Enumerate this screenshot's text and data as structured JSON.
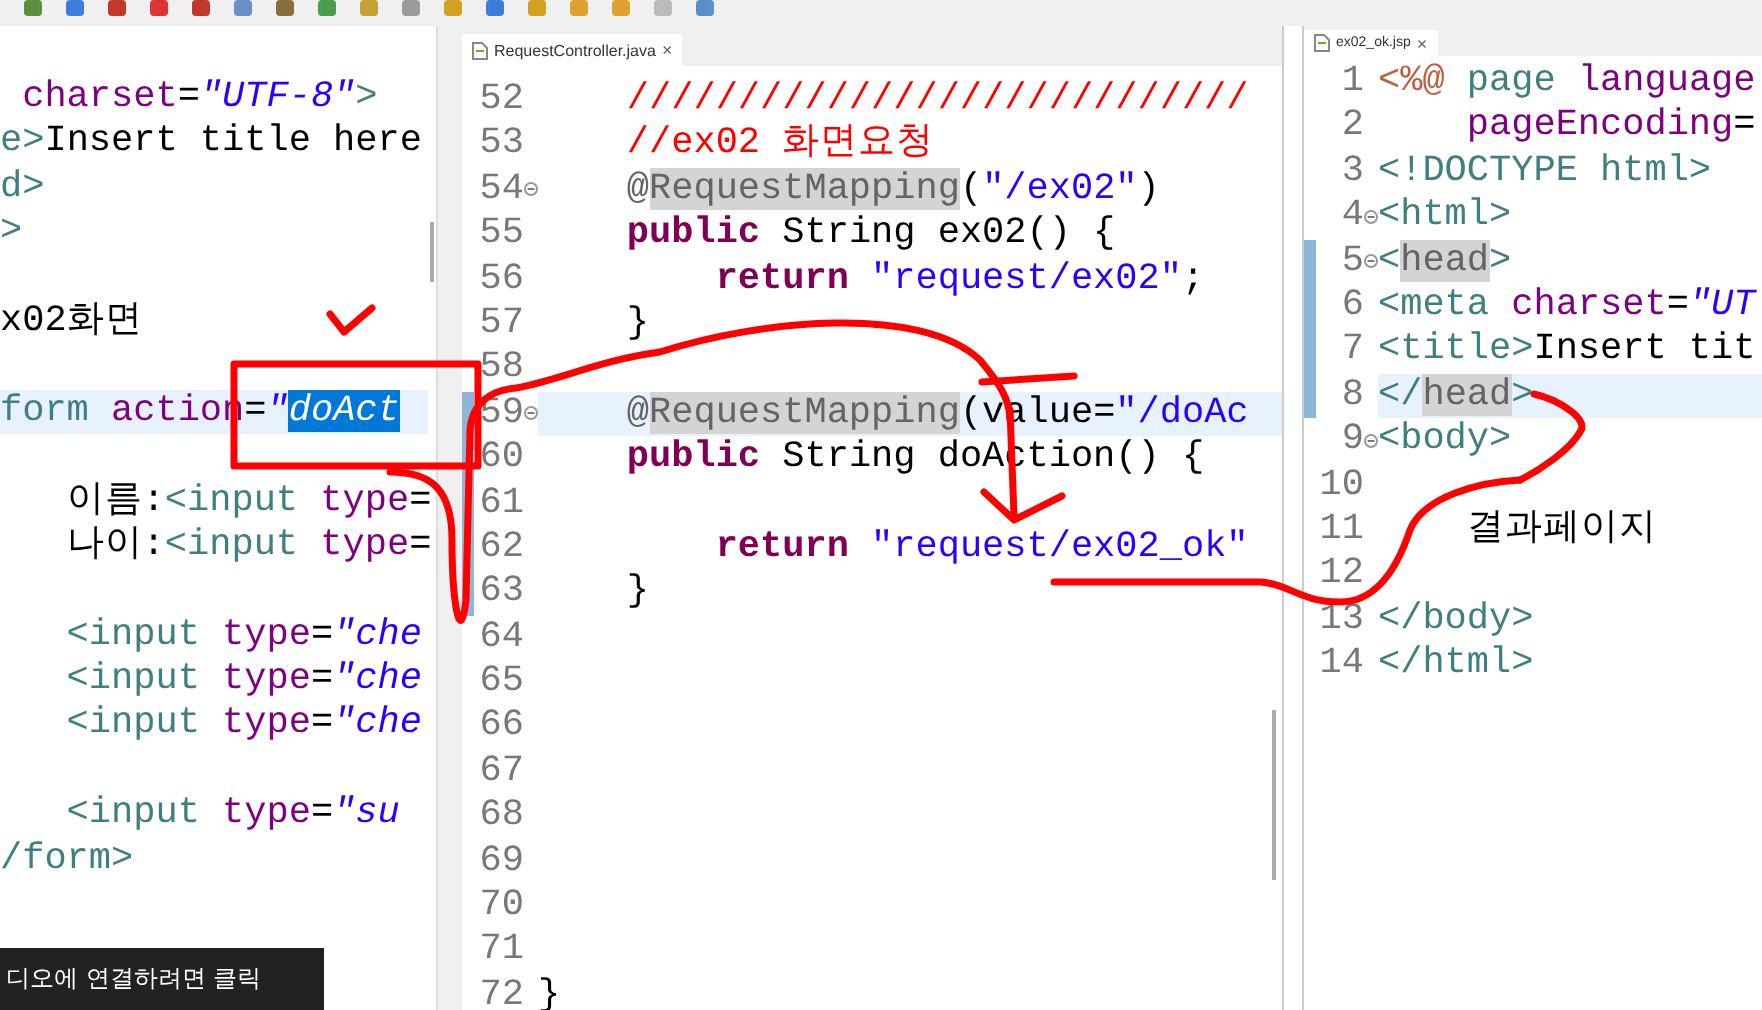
{
  "left_editor": {
    "lines": [
      {
        "current": false,
        "tokens": [
          {
            "kind": "attr",
            "text": " charset"
          },
          {
            "kind": "punct",
            "text": "="
          },
          {
            "kind": "string",
            "text": "\"UTF-8\""
          },
          {
            "kind": "tag",
            "text": ">"
          }
        ]
      },
      {
        "current": false,
        "tokens": [
          {
            "kind": "tag",
            "text": "e>"
          },
          {
            "kind": "text",
            "text": "Insert title here"
          }
        ]
      },
      {
        "current": false,
        "tokens": [
          {
            "kind": "tag",
            "text": "d>"
          }
        ]
      },
      {
        "current": false,
        "tokens": [
          {
            "kind": "tag",
            "text": ">"
          }
        ]
      },
      {
        "current": false
      },
      {
        "current": false,
        "tokens": [
          {
            "kind": "text",
            "text": "x02화면"
          }
        ]
      },
      {
        "current": false
      },
      {
        "current": true,
        "tokens": [
          {
            "kind": "tag",
            "text": "form "
          },
          {
            "kind": "attr",
            "text": "action"
          },
          {
            "kind": "punct",
            "text": "="
          },
          {
            "kind": "string",
            "text": "\""
          },
          {
            "kind": "selection",
            "text": "doAct"
          }
        ]
      },
      {
        "current": false
      },
      {
        "current": false,
        "tokens": [
          {
            "kind": "text",
            "text": "   이름:"
          },
          {
            "kind": "tag",
            "text": "<input "
          },
          {
            "kind": "attr",
            "text": "type"
          },
          {
            "kind": "punct",
            "text": "="
          }
        ]
      },
      {
        "current": false,
        "tokens": [
          {
            "kind": "text",
            "text": "   나이:"
          },
          {
            "kind": "tag",
            "text": "<input "
          },
          {
            "kind": "attr",
            "text": "type"
          },
          {
            "kind": "punct",
            "text": "="
          }
        ]
      },
      {
        "current": false
      },
      {
        "current": false,
        "tokens": [
          {
            "kind": "tag",
            "text": "   <input "
          },
          {
            "kind": "attr",
            "text": "type"
          },
          {
            "kind": "punct",
            "text": "="
          },
          {
            "kind": "string",
            "text": "\"che"
          }
        ]
      },
      {
        "current": false,
        "tokens": [
          {
            "kind": "tag",
            "text": "   <input "
          },
          {
            "kind": "attr",
            "text": "type"
          },
          {
            "kind": "punct",
            "text": "="
          },
          {
            "kind": "string",
            "text": "\"che"
          }
        ]
      },
      {
        "current": false,
        "tokens": [
          {
            "kind": "tag",
            "text": "   <input "
          },
          {
            "kind": "attr",
            "text": "type"
          },
          {
            "kind": "punct",
            "text": "="
          },
          {
            "kind": "string",
            "text": "\"che"
          }
        ]
      },
      {
        "current": false
      },
      {
        "current": false,
        "tokens": [
          {
            "kind": "tag",
            "text": "   <input "
          },
          {
            "kind": "attr",
            "text": "type"
          },
          {
            "kind": "punct",
            "text": "="
          },
          {
            "kind": "string",
            "text": "\"su"
          }
        ]
      },
      {
        "current": false,
        "tokens": [
          {
            "kind": "tag",
            "text": "/form>"
          }
        ]
      }
    ]
  },
  "middle_editor": {
    "tab": {
      "label": "RequestController.java",
      "close": "×"
    },
    "lines": [
      {
        "number": "52",
        "fold": false,
        "changed": false,
        "current": false,
        "tokens": [
          {
            "kind": "comment",
            "text": "    ////////////////////////////"
          }
        ]
      },
      {
        "number": "53",
        "fold": false,
        "changed": false,
        "current": false,
        "tokens": [
          {
            "kind": "comment",
            "text": "    //ex02 화면요청"
          }
        ]
      },
      {
        "number": "54",
        "fold": true,
        "changed": false,
        "current": false,
        "tokens": [
          {
            "kind": "annotation",
            "text": "    @"
          },
          {
            "kind": "mark",
            "text": "RequestMapping"
          },
          {
            "kind": "punct",
            "text": "("
          },
          {
            "kind": "jstring",
            "text": "\"/ex02\""
          },
          {
            "kind": "punct",
            "text": ")"
          }
        ]
      },
      {
        "number": "55",
        "fold": false,
        "changed": false,
        "current": false,
        "tokens": [
          {
            "kind": "keyword",
            "text": "    public"
          },
          {
            "kind": "punct",
            "text": " String ex02() {"
          }
        ]
      },
      {
        "number": "56",
        "fold": false,
        "changed": false,
        "current": false,
        "tokens": [
          {
            "kind": "keyword",
            "text": "        return"
          },
          {
            "kind": "jstring",
            "text": " \"request/ex02\""
          },
          {
            "kind": "punct",
            "text": ";"
          }
        ]
      },
      {
        "number": "57",
        "fold": false,
        "changed": false,
        "current": false,
        "tokens": [
          {
            "kind": "punct",
            "text": "    }"
          }
        ]
      },
      {
        "number": "58",
        "fold": false,
        "changed": false,
        "current": false
      },
      {
        "number": "59",
        "fold": true,
        "changed": true,
        "current": true,
        "tokens": [
          {
            "kind": "annotation",
            "text": "    @"
          },
          {
            "kind": "mark",
            "text": "RequestMapping"
          },
          {
            "kind": "punct",
            "text": "(value="
          },
          {
            "kind": "jstring",
            "text": "\"/doAc"
          }
        ]
      },
      {
        "number": "60",
        "fold": false,
        "changed": true,
        "current": false,
        "tokens": [
          {
            "kind": "keyword",
            "text": "    public"
          },
          {
            "kind": "punct",
            "text": " String doAction() {"
          }
        ]
      },
      {
        "number": "61",
        "fold": false,
        "changed": true,
        "current": false
      },
      {
        "number": "62",
        "fold": false,
        "changed": true,
        "current": false,
        "tokens": [
          {
            "kind": "keyword",
            "text": "        return"
          },
          {
            "kind": "jstring",
            "text": " \"request/ex02_ok\""
          }
        ]
      },
      {
        "number": "63",
        "fold": false,
        "changed": true,
        "current": false,
        "tokens": [
          {
            "kind": "punct",
            "text": "    }"
          }
        ]
      },
      {
        "number": "64",
        "fold": false,
        "changed": false,
        "current": false
      },
      {
        "number": "65",
        "fold": false,
        "changed": false,
        "current": false
      },
      {
        "number": "66",
        "fold": false,
        "changed": false,
        "current": false
      },
      {
        "number": "67",
        "fold": false,
        "changed": false,
        "current": false
      },
      {
        "number": "68",
        "fold": false,
        "changed": false,
        "current": false
      },
      {
        "number": "69",
        "fold": false,
        "changed": false,
        "current": false
      },
      {
        "number": "70",
        "fold": false,
        "changed": false,
        "current": false
      },
      {
        "number": "71",
        "fold": false,
        "changed": false,
        "current": false
      },
      {
        "number": "72",
        "fold": false,
        "changed": false,
        "current": false,
        "tokens": [
          {
            "kind": "punct",
            "text": "}"
          }
        ]
      }
    ]
  },
  "right_editor": {
    "tab": {
      "label": "ex02_ok.jsp",
      "close": "×"
    },
    "lines": [
      {
        "number": "1",
        "fold": false,
        "changed": false,
        "current": false,
        "tokens": [
          {
            "kind": "directive",
            "text": "<%@"
          },
          {
            "kind": "tag",
            "text": " page "
          },
          {
            "kind": "attr",
            "text": "language"
          }
        ]
      },
      {
        "number": "2",
        "fold": false,
        "changed": false,
        "current": false,
        "tokens": [
          {
            "kind": "attr",
            "text": "    pageEncoding"
          },
          {
            "kind": "punct",
            "text": "="
          }
        ]
      },
      {
        "number": "3",
        "fold": false,
        "changed": false,
        "current": false,
        "tokens": [
          {
            "kind": "tag",
            "text": "<!DOCTYPE html>"
          }
        ]
      },
      {
        "number": "4",
        "fold": true,
        "changed": false,
        "current": false,
        "tokens": [
          {
            "kind": "tag",
            "text": "<html>"
          }
        ]
      },
      {
        "number": "5",
        "fold": true,
        "changed": true,
        "current": false,
        "tokens": [
          {
            "kind": "tag",
            "text": "<"
          },
          {
            "kind": "mark",
            "text": "head"
          },
          {
            "kind": "tag",
            "text": ">"
          }
        ]
      },
      {
        "number": "6",
        "fold": false,
        "changed": true,
        "current": false,
        "tokens": [
          {
            "kind": "tag",
            "text": "<meta "
          },
          {
            "kind": "attr",
            "text": "charset"
          },
          {
            "kind": "punct",
            "text": "="
          },
          {
            "kind": "string",
            "text": "\"UT"
          }
        ]
      },
      {
        "number": "7",
        "fold": false,
        "changed": true,
        "current": false,
        "tokens": [
          {
            "kind": "tag",
            "text": "<title>"
          },
          {
            "kind": "text",
            "text": "Insert tit"
          }
        ]
      },
      {
        "number": "8",
        "fold": false,
        "changed": true,
        "current": true,
        "tokens": [
          {
            "kind": "tag",
            "text": "</"
          },
          {
            "kind": "mark",
            "text": "head"
          },
          {
            "kind": "tag",
            "text": ">"
          }
        ]
      },
      {
        "number": "9",
        "fold": true,
        "changed": false,
        "current": false,
        "tokens": [
          {
            "kind": "tag",
            "text": "<body>"
          }
        ]
      },
      {
        "number": "10",
        "fold": false,
        "changed": false,
        "current": false
      },
      {
        "number": "11",
        "fold": false,
        "changed": false,
        "current": false,
        "tokens": [
          {
            "kind": "text",
            "text": "    결과페이지"
          }
        ]
      },
      {
        "number": "12",
        "fold": false,
        "changed": false,
        "current": false
      },
      {
        "number": "13",
        "fold": false,
        "changed": false,
        "current": false,
        "tokens": [
          {
            "kind": "tag",
            "text": "</body>"
          }
        ]
      },
      {
        "number": "14",
        "fold": false,
        "changed": false,
        "current": false,
        "tokens": [
          {
            "kind": "tag",
            "text": "</html>"
          }
        ]
      }
    ]
  },
  "tooltip": "디오에 연결하려면 클릭"
}
